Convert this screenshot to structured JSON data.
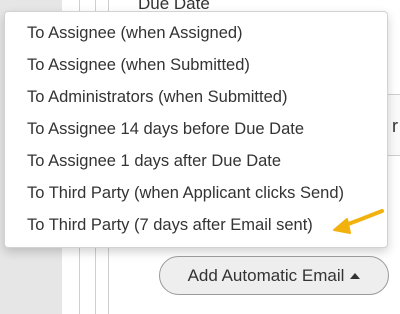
{
  "background": {
    "heading_partial": "Due Date",
    "tab_partial": "r"
  },
  "menu": {
    "items": [
      {
        "label": "To Assignee (when Assigned)"
      },
      {
        "label": "To Assignee (when Submitted)"
      },
      {
        "label": "To Administrators (when Submitted)"
      },
      {
        "label": "To Assignee 14 days before Due Date"
      },
      {
        "label": "To Assignee 1 days after Due Date"
      },
      {
        "label": "To Third Party (when Applicant clicks Send)"
      },
      {
        "label": "To Third Party (7 days after Email sent)"
      }
    ]
  },
  "add_button": {
    "label": "Add Automatic Email"
  },
  "colors": {
    "annotation_arrow": "#f2b10d"
  },
  "icons": {
    "add_button_caret": "caret-up-icon",
    "annotation": "arrow-left-icon"
  }
}
